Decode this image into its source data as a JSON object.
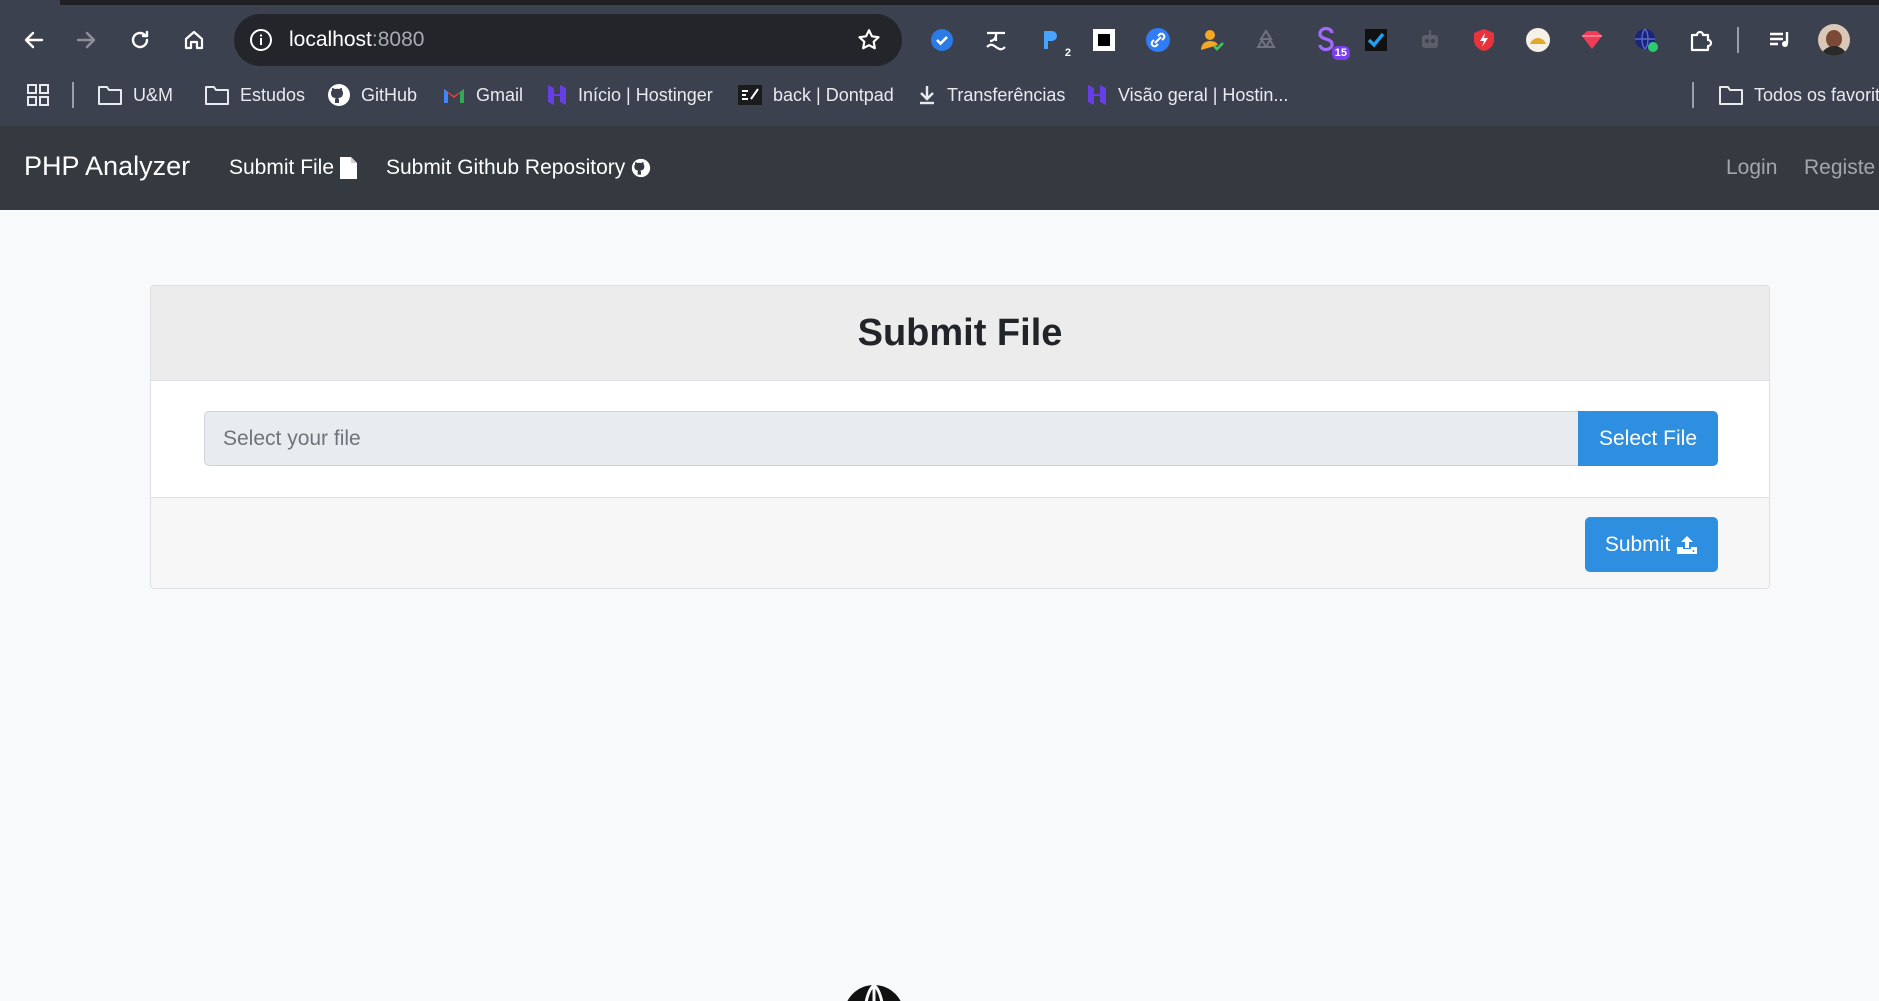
{
  "browser": {
    "url_host": "localhost",
    "url_port": ":8080",
    "extensions": [
      {
        "icon": "check-circle-icon"
      },
      {
        "icon": "translate-icon"
      },
      {
        "icon": "p-icon",
        "badge": "2"
      },
      {
        "icon": "square-icon"
      },
      {
        "icon": "link-icon"
      },
      {
        "icon": "person-check-icon"
      },
      {
        "icon": "recycle-icon"
      },
      {
        "icon": "s-icon",
        "badge": "15"
      },
      {
        "icon": "checkbox-icon"
      },
      {
        "icon": "robot-icon"
      },
      {
        "icon": "bolt-shield-icon"
      },
      {
        "icon": "cookie-icon"
      },
      {
        "icon": "gem-icon"
      },
      {
        "icon": "globe-icon"
      },
      {
        "icon": "puzzle-icon"
      },
      {
        "icon": "media-queue-icon"
      }
    ],
    "bookmarks": [
      {
        "label": "U&M",
        "icon": "folder-icon"
      },
      {
        "label": "Estudos",
        "icon": "folder-icon"
      },
      {
        "label": "GitHub",
        "icon": "github-icon"
      },
      {
        "label": "Gmail",
        "icon": "gmail-icon"
      },
      {
        "label": "Início | Hostinger",
        "icon": "hostinger-icon"
      },
      {
        "label": "back | Dontpad",
        "icon": "dontpad-icon"
      },
      {
        "label": "Transferências",
        "icon": "download-icon"
      },
      {
        "label": "Visão geral | Hostin...",
        "icon": "hostinger-icon"
      },
      {
        "label": "Todos os favorit",
        "icon": "folder-icon"
      }
    ]
  },
  "navbar": {
    "brand": "PHP Analyzer",
    "submit_file": "Submit File",
    "submit_repo": "Submit Github Repository",
    "login": "Login",
    "register": "Registe"
  },
  "card": {
    "title": "Submit File",
    "file_placeholder": "Select your file",
    "select_button": "Select File",
    "submit_button": "Submit"
  },
  "colors": {
    "navbar_bg": "#343a40",
    "primary": "#2e8fe0",
    "page_bg": "#f8f9fa"
  }
}
